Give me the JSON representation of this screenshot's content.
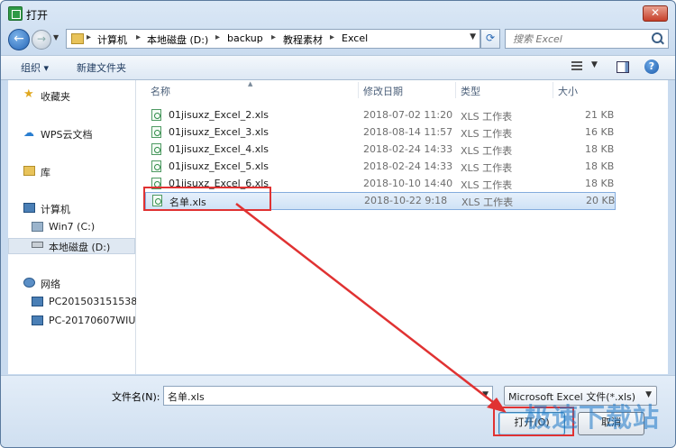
{
  "window": {
    "title": "打开",
    "close_label": "✕"
  },
  "address": {
    "parts": [
      "计算机",
      "本地磁盘 (D:)",
      "backup",
      "教程素材",
      "Excel"
    ]
  },
  "search": {
    "placeholder": "搜索 Excel"
  },
  "toolbar": {
    "organize": "组织 ▾",
    "new_folder": "新建文件夹",
    "help": "?"
  },
  "sidebar": {
    "favorites": "收藏夹",
    "wps_cloud": "WPS云文档",
    "libraries": "库",
    "computer": "计算机",
    "drive_c": "Win7 (C:)",
    "drive_d": "本地磁盘 (D:)",
    "network": "网络",
    "pc1": "PC201503151538",
    "pc2": "PC-20170607WIUN"
  },
  "columns": {
    "name": "名称",
    "modified": "修改日期",
    "type": "类型",
    "size": "大小"
  },
  "files": [
    {
      "name": "01jisuxz_Excel_2.xls",
      "date": "2018-07-02 11:20",
      "type": "XLS 工作表",
      "size": "21 KB"
    },
    {
      "name": "01jisuxz_Excel_3.xls",
      "date": "2018-08-14 11:57",
      "type": "XLS 工作表",
      "size": "16 KB"
    },
    {
      "name": "01jisuxz_Excel_4.xls",
      "date": "2018-02-24 14:33",
      "type": "XLS 工作表",
      "size": "18 KB"
    },
    {
      "name": "01jisuxz_Excel_5.xls",
      "date": "2018-02-24 14:33",
      "type": "XLS 工作表",
      "size": "18 KB"
    },
    {
      "name": "01jisuxz_Excel_6.xls",
      "date": "2018-10-10 14:40",
      "type": "XLS 工作表",
      "size": "18 KB"
    },
    {
      "name": "名单.xls",
      "date": "2018-10-22 9:18",
      "type": "XLS 工作表",
      "size": "20 KB"
    }
  ],
  "footer": {
    "filename_label": "文件名(N):",
    "filename_value": "名单.xls",
    "filetype_value": "Microsoft Excel 文件(*.xls)",
    "open_label": "打开(O)",
    "cancel_label": "取消"
  },
  "watermark": "极速下载站",
  "colors": {
    "highlight": "#e03232",
    "selection": "#cfe2f6",
    "accent": "#2767b8"
  }
}
